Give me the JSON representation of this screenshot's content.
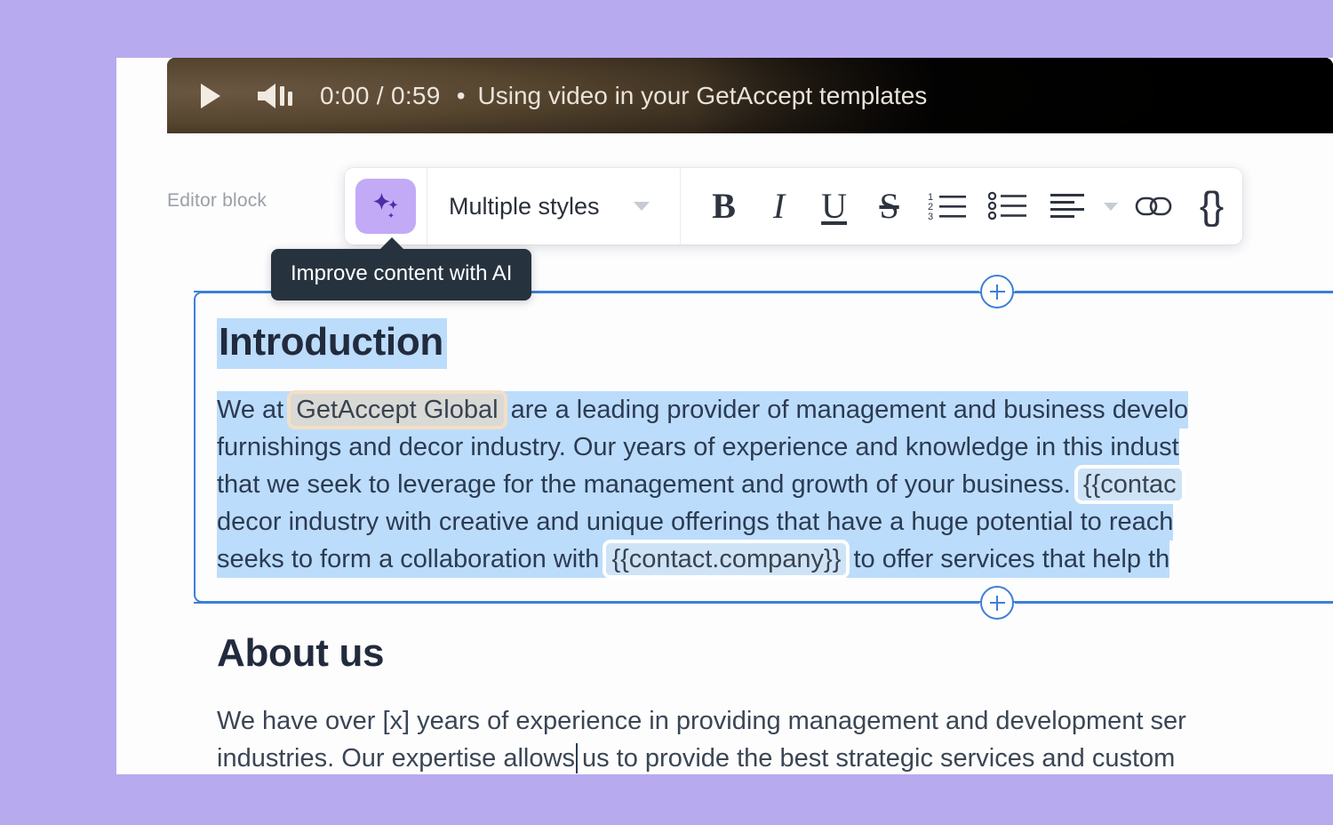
{
  "theme": {
    "page_background": "#b8aaee",
    "accent_blue": "#3d7fd6",
    "ai_purple": "#c3aaf7",
    "selection_blue": "#bcdcfb",
    "tooltip_bg": "#26333f",
    "heading_color": "#222b3d"
  },
  "video": {
    "play_icon": "play-icon",
    "volume_icon": "volume-icon",
    "current_time": "0:00",
    "time_separator": "/",
    "duration": "0:59",
    "bullet": "•",
    "title": "Using video in your GetAccept templates"
  },
  "editor": {
    "block_label": "Editor block"
  },
  "toolbar": {
    "ai_button": {
      "icon": "sparkles-icon",
      "tooltip": "Improve content with AI"
    },
    "style_dropdown": {
      "value": "Multiple styles",
      "caret_icon": "chevron-down-icon"
    },
    "tools": [
      {
        "name": "bold-button",
        "glyph": "B",
        "icon": "bold-icon"
      },
      {
        "name": "italic-button",
        "glyph": "I",
        "icon": "italic-icon"
      },
      {
        "name": "underline-button",
        "glyph": "U",
        "icon": "underline-icon"
      },
      {
        "name": "strikethrough-button",
        "glyph": "S",
        "icon": "strikethrough-icon"
      },
      {
        "name": "ordered-list-button",
        "icon": "ordered-list-icon"
      },
      {
        "name": "bulleted-list-button",
        "icon": "bulleted-list-icon"
      },
      {
        "name": "align-button",
        "icon": "align-left-icon"
      },
      {
        "name": "align-caret",
        "icon": "chevron-down-icon"
      },
      {
        "name": "link-button",
        "icon": "link-icon"
      },
      {
        "name": "variable-button",
        "glyph": "{}",
        "icon": "curly-braces-icon"
      }
    ]
  },
  "document": {
    "blocks": [
      {
        "id": "introduction",
        "selected": true,
        "heading": "Introduction",
        "paragraph_lines": [
          [
            {
              "type": "text",
              "value": "We at "
            },
            {
              "type": "variable",
              "value": "GetAccept Global",
              "style": "highlighted"
            },
            {
              "type": "text",
              "value": " are a leading provider of management and business develo"
            }
          ],
          [
            {
              "type": "text",
              "value": "furnishings and decor industry. Our years of experience and knowledge in this indust"
            }
          ],
          [
            {
              "type": "text",
              "value": "that we seek to leverage for the management and growth of your business. "
            },
            {
              "type": "variable",
              "value": "{{contac",
              "style": "plain"
            }
          ],
          [
            {
              "type": "text",
              "value": "decor industry with creative and unique offerings that have a huge potential to reach"
            }
          ],
          [
            {
              "type": "text",
              "value": "seeks to form a collaboration with "
            },
            {
              "type": "variable",
              "value": "{{contact.company}}",
              "style": "plain"
            },
            {
              "type": "text",
              "value": " to offer services that help th"
            }
          ]
        ],
        "add_block_above_label": "+",
        "add_block_below_label": "+"
      },
      {
        "id": "about-us",
        "selected": false,
        "heading": "About us",
        "paragraph_lines": [
          [
            {
              "type": "text",
              "value": "We have over [x] years of experience in providing management and development ser"
            }
          ],
          [
            {
              "type": "text",
              "value": "industries. Our expertise allows us to provide the best strategic services and custom"
            }
          ]
        ]
      }
    ]
  }
}
